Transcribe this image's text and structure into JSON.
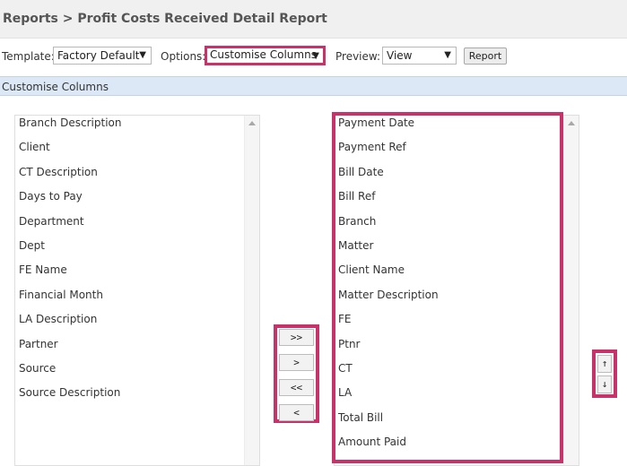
{
  "header": {
    "title": "Reports > Profit Costs Received Detail Report"
  },
  "toolbar": {
    "template_label": "Template:",
    "template_value": "Factory Default",
    "options_label": "Options:",
    "options_value": "Customise Columns",
    "preview_label": "Preview:",
    "preview_value": "View",
    "dropdown_icon": "▼",
    "report_button": "Report"
  },
  "section": {
    "title": "Customise Columns"
  },
  "available_columns": [
    "Branch Description",
    "Client",
    "CT Description",
    "Days to Pay",
    "Department",
    "Dept",
    "FE Name",
    "Financial Month",
    "LA Description",
    "Partner",
    "Source",
    "Source Description"
  ],
  "selected_columns": [
    "Payment Date",
    "Payment Ref",
    "Bill Date",
    "Bill Ref",
    "Branch",
    "Matter",
    "Client Name",
    "Matter Description",
    "FE",
    "Ptnr",
    "CT",
    "LA",
    "Total Bill",
    "Amount Paid"
  ],
  "move_buttons": {
    "add_all": ">>",
    "add": ">",
    "remove_all": "<<",
    "remove": "<"
  },
  "order_buttons": {
    "up": "↑",
    "down": "↓"
  },
  "colors": {
    "highlight": "#c8326b",
    "section_header_bg": "#dde8f7",
    "title_bar_bg": "#f0f0f0"
  },
  "icons": {
    "dropdown": "caret-down-icon",
    "scroll_up": "scroll-up-icon",
    "move_up": "arrow-up-icon",
    "move_down": "arrow-down-icon"
  }
}
